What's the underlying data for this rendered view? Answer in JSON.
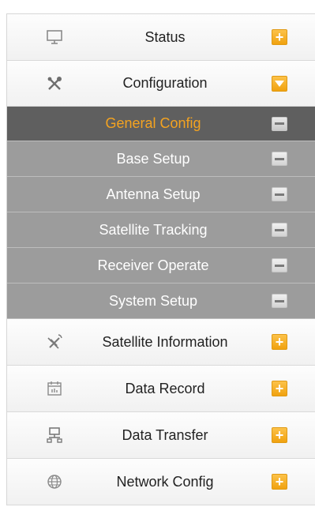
{
  "menu": {
    "status": {
      "label": "Status",
      "icon": "monitor-icon",
      "toggle": "+"
    },
    "configuration": {
      "label": "Configuration",
      "icon": "tools-icon",
      "toggle": "collapse"
    },
    "sub_items": [
      {
        "label": "General Config",
        "active": true
      },
      {
        "label": "Base Setup"
      },
      {
        "label": "Antenna Setup"
      },
      {
        "label": "Satellite Tracking"
      },
      {
        "label": "Receiver Operate"
      },
      {
        "label": "System Setup"
      }
    ],
    "satellite_information": {
      "label": "Satellite Information",
      "icon": "satellite-icon",
      "toggle": "+"
    },
    "data_record": {
      "label": "Data Record",
      "icon": "calendar-icon",
      "toggle": "+"
    },
    "data_transfer": {
      "label": "Data Transfer",
      "icon": "network-icon",
      "toggle": "+"
    },
    "network_config": {
      "label": "Network Config",
      "icon": "globe-icon",
      "toggle": "+"
    }
  },
  "colors": {
    "accent": "#f4a320",
    "active_sub_bg": "#5f5f5f",
    "sub_bg": "#9c9c9c"
  }
}
